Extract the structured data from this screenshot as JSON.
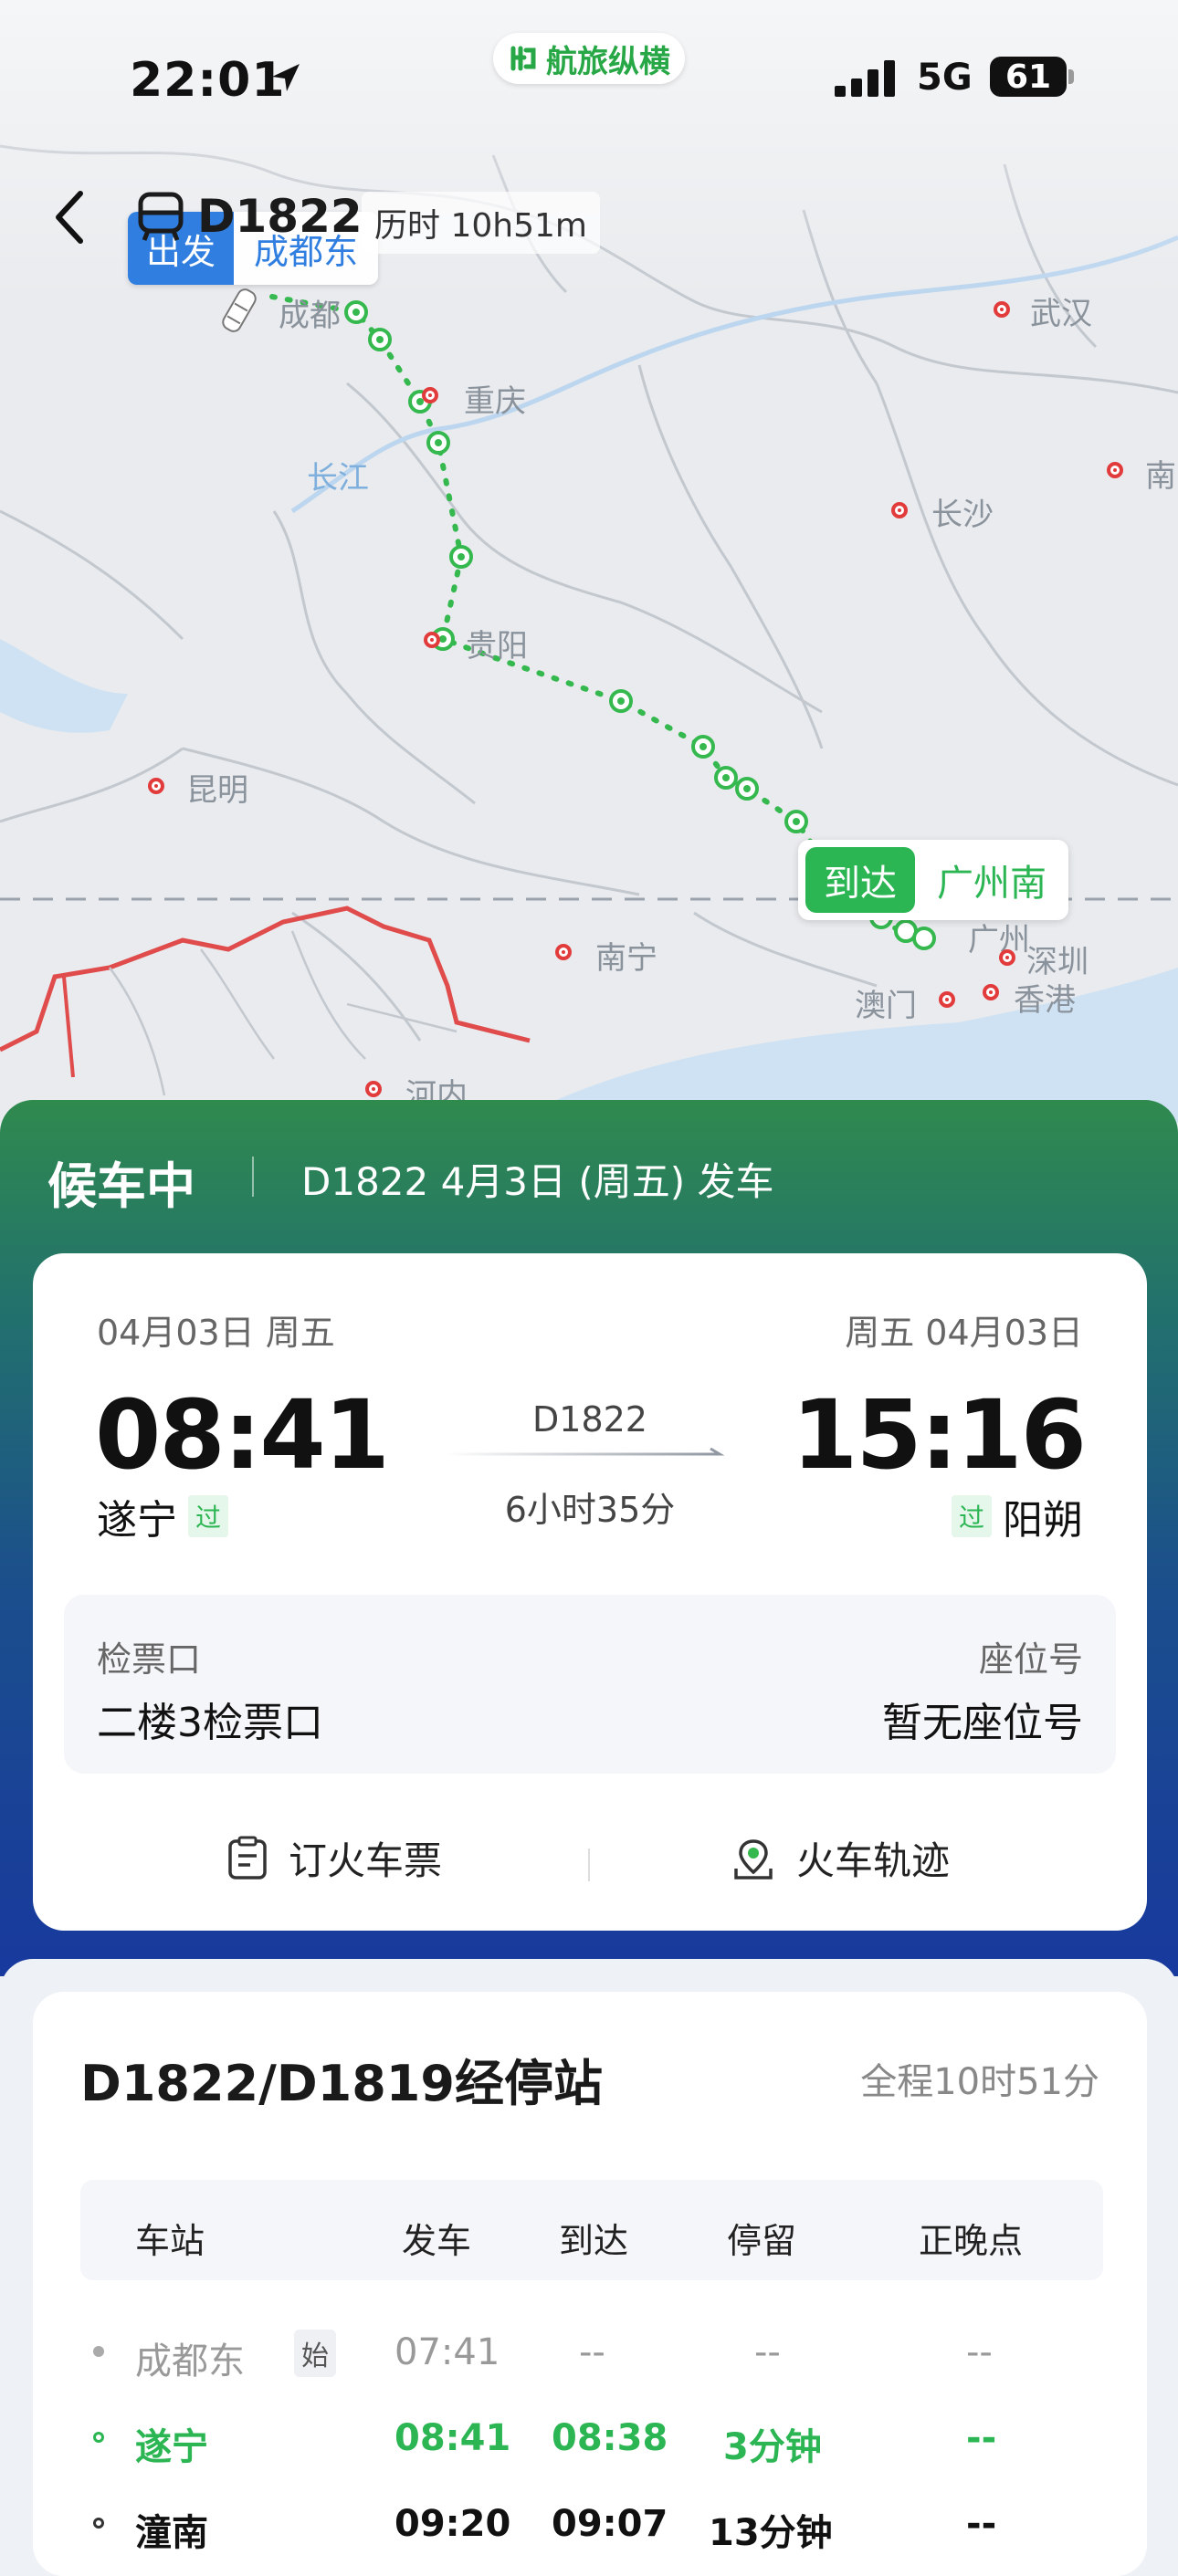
{
  "status_bar": {
    "time": "22:01",
    "app_name": "航旅纵横",
    "network": "5G",
    "battery": "61"
  },
  "header": {
    "train": "D1822",
    "duration": "历时 10h51m"
  },
  "map": {
    "depart_tag": "出发",
    "depart_station": "成都东",
    "arrive_tag": "到达",
    "arrive_station": "广州南",
    "cities": {
      "chengdu": "成都",
      "wuhan": "武汉",
      "chongqing": "重庆",
      "yangtze": "长江",
      "changsha": "长沙",
      "nan": "南",
      "guiyang": "贵阳",
      "kunming": "昆明",
      "nanning": "南宁",
      "guangzhou": "广州",
      "shenzhen": "深圳",
      "hongkong": "香港",
      "macau": "澳门",
      "hanoi": "河内"
    }
  },
  "status": {
    "state": "候车中",
    "info": "D1822 4月3日 (周五) 发车"
  },
  "ticket": {
    "dep_date": "04月03日 周五",
    "arr_date": "周五 04月03日",
    "dep_time": "08:41",
    "arr_time": "15:16",
    "dep_station": "遂宁",
    "arr_station": "阳朔",
    "pass_badge": "过",
    "train": "D1822",
    "duration": "6小时35分",
    "gate_label": "检票口",
    "gate_value": "二楼3检票口",
    "seat_label": "座位号",
    "seat_value": "暂无座位号",
    "book_label": "订火车票",
    "track_label": "火车轨迹"
  },
  "stops": {
    "title": "D1822/D1819经停站",
    "total": "全程10时51分",
    "headers": [
      "车站",
      "发车",
      "到达",
      "停留",
      "正晚点"
    ],
    "start_badge": "始",
    "rows": [
      {
        "station": "成都东",
        "depart": "07:41",
        "arrive": "--",
        "stay": "--",
        "delay": "--"
      },
      {
        "station": "遂宁",
        "depart": "08:41",
        "arrive": "08:38",
        "stay": "3分钟",
        "delay": "--"
      },
      {
        "station": "潼南",
        "depart": "09:20",
        "arrive": "09:07",
        "stay": "13分钟",
        "delay": "--"
      }
    ]
  },
  "colors": {
    "green": "#2bb553",
    "blue": "#2f7ee0",
    "gradient_top": "#2f8a4e",
    "gradient_bottom": "#18399e"
  }
}
